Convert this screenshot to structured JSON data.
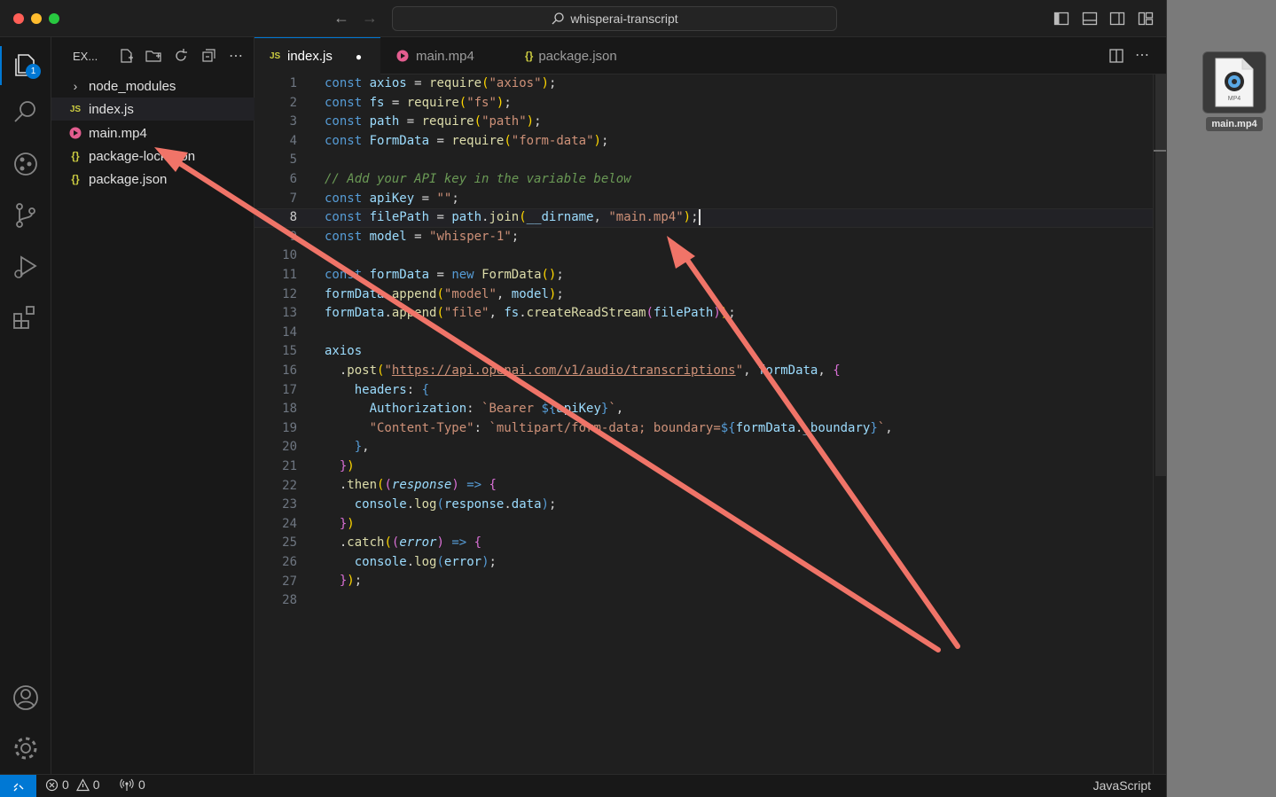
{
  "window": {
    "title": "whisperai-transcript"
  },
  "sidebar": {
    "header": "EX...",
    "items": [
      {
        "label": "node_modules",
        "type": "folder"
      },
      {
        "label": "index.js",
        "type": "js",
        "icon": "JS"
      },
      {
        "label": "main.mp4",
        "type": "video"
      },
      {
        "label": "package-lock.json",
        "type": "json",
        "icon": "{}"
      },
      {
        "label": "package.json",
        "type": "json",
        "icon": "{}"
      }
    ]
  },
  "activity": {
    "explorer_badge": "1"
  },
  "tabs": [
    {
      "label": "index.js",
      "icon": "JS",
      "modified": "●"
    },
    {
      "label": "main.mp4"
    },
    {
      "label": "package.json",
      "icon": "{}"
    }
  ],
  "editor": {
    "active_line": "8",
    "line_numbers": [
      "1",
      "2",
      "3",
      "4",
      "5",
      "6",
      "7",
      "8",
      "9",
      "10",
      "11",
      "12",
      "13",
      "14",
      "15",
      "16",
      "17",
      "18",
      "19",
      "20",
      "21",
      "22",
      "23",
      "24",
      "25",
      "26",
      "27",
      "28"
    ],
    "comment": "// Add your API key in the variable below",
    "url": "https://api.openai.com/v1/audio/transcriptions"
  },
  "status": {
    "errors": "0",
    "warnings": "0",
    "ports": "0",
    "language": "JavaScript"
  },
  "desktop": {
    "file_label": "main.mp4",
    "file_type": "MP4"
  },
  "colors": {
    "accent": "#0078d4",
    "arrow": "#f07468",
    "editor_bg": "#1f1f1f"
  }
}
